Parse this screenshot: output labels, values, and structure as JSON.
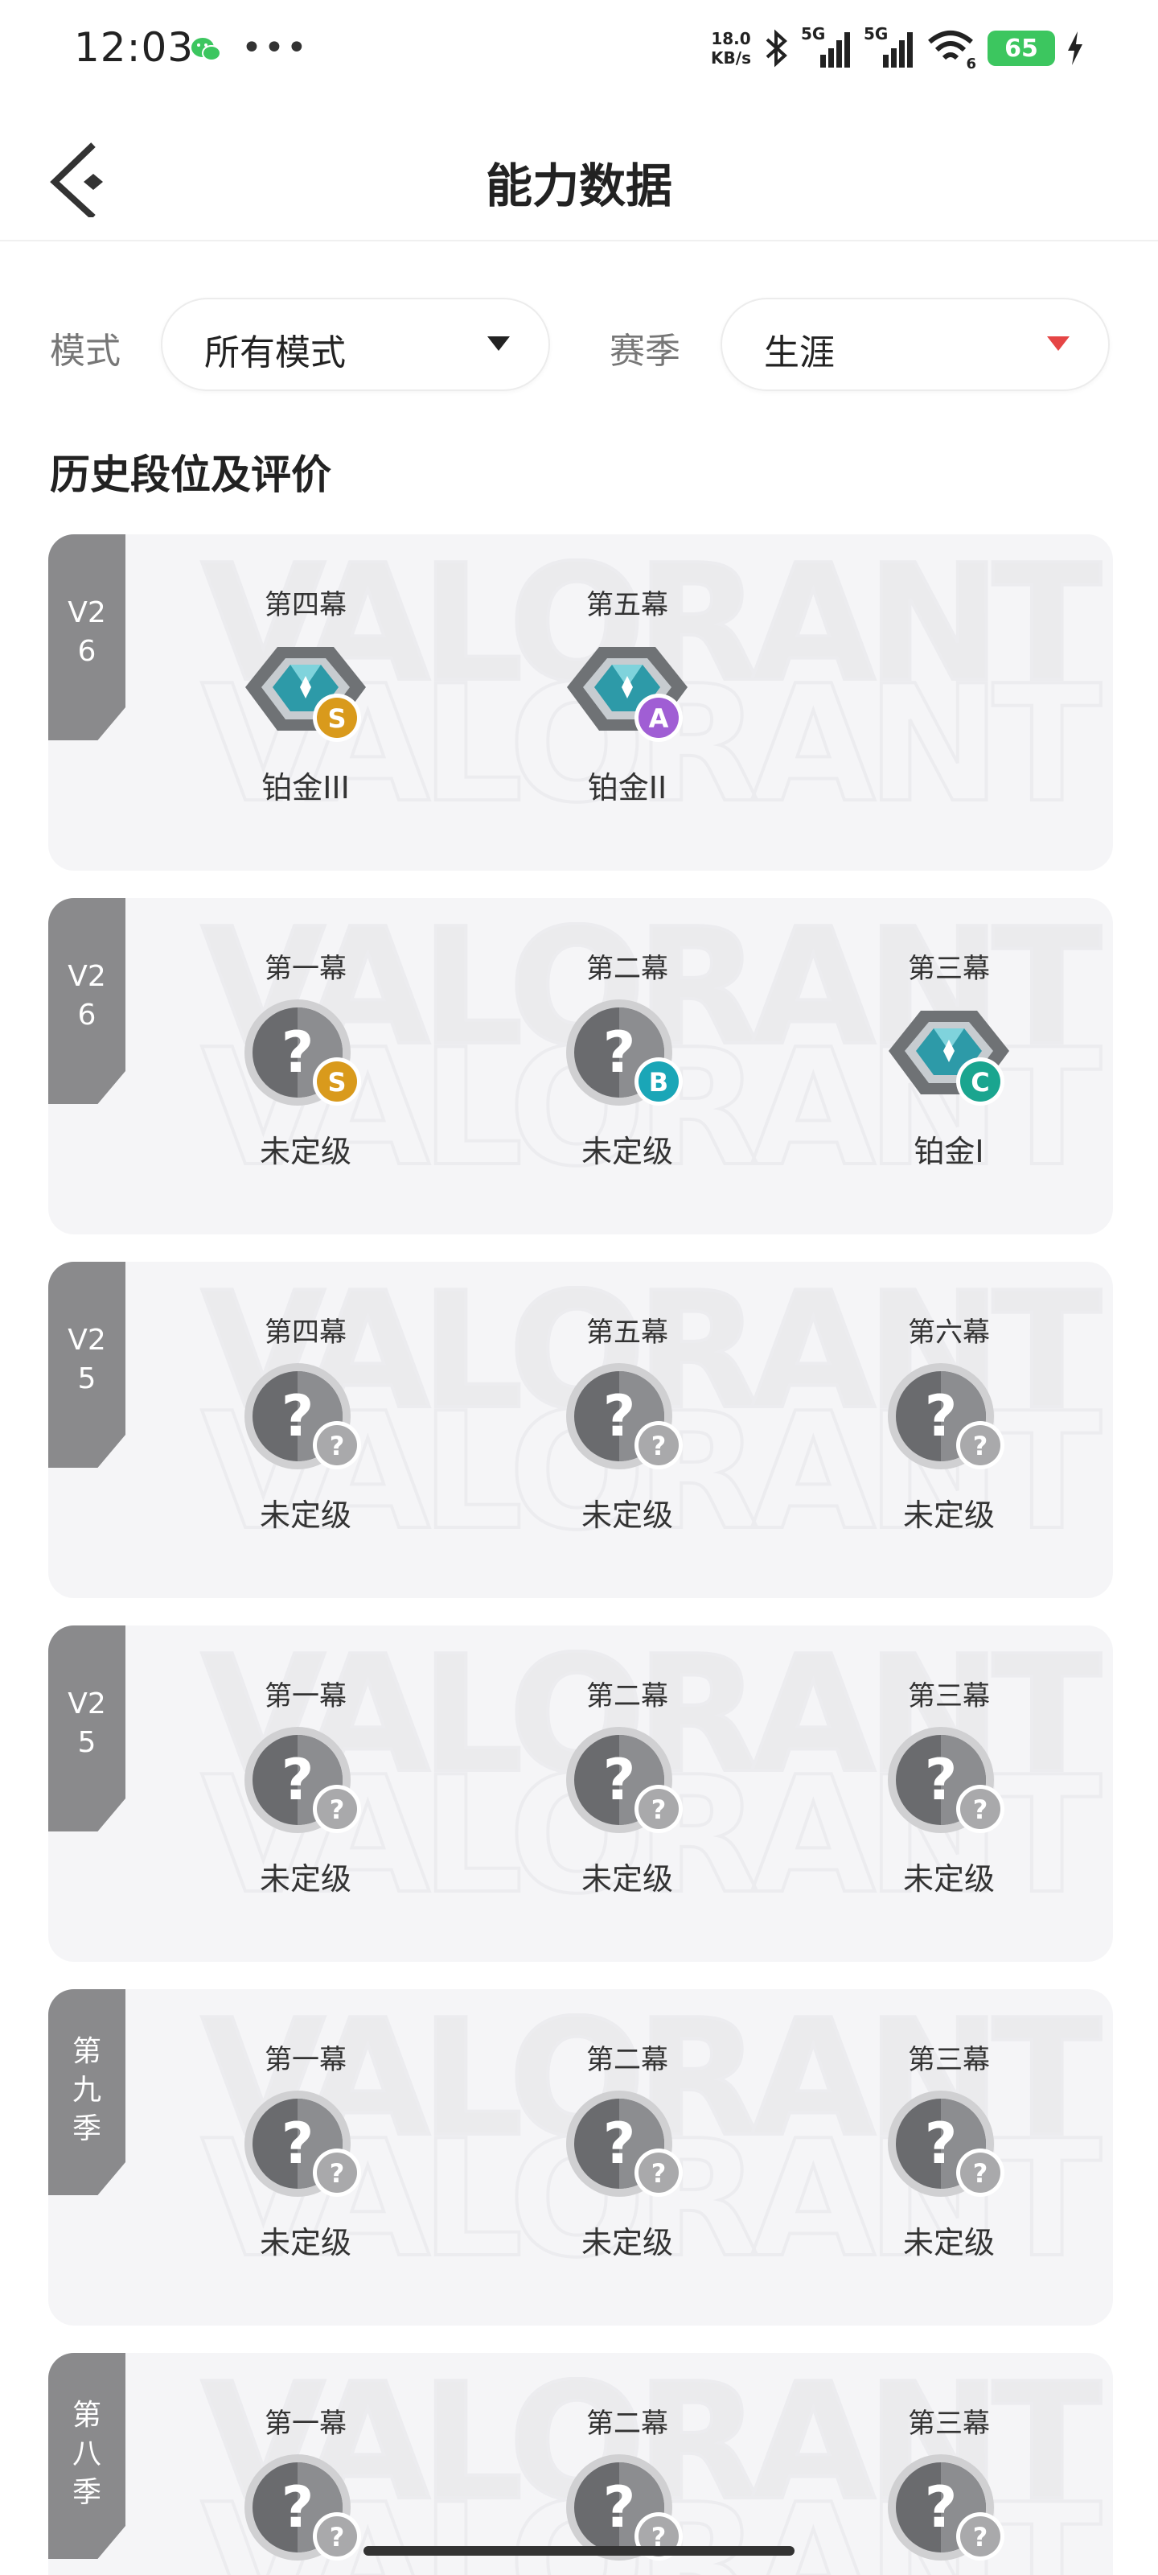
{
  "status_bar": {
    "time": "12:03",
    "net_speed": "18.0",
    "net_unit": "KB/s",
    "signal1": "5G",
    "signal2": "5G",
    "wifi_num": "6",
    "battery": "65",
    "icons": [
      "wechat-icon",
      "more-dots-icon",
      "bluetooth-icon",
      "signal-icon",
      "wifi-icon",
      "battery-icon",
      "charging-icon"
    ]
  },
  "header": {
    "title": "能力数据",
    "back_icon": "back-arrow-icon"
  },
  "filters": {
    "mode_label": "模式",
    "mode_value": "所有模式",
    "season_label": "赛季",
    "season_value": "生涯"
  },
  "section_title": "历史段位及评价",
  "watermark_text": "VALORANT",
  "colors": {
    "grade_S": "#d99a1c",
    "grade_A": "#a05ed4",
    "grade_B": "#1aa6b7",
    "grade_C": "#1aa58f",
    "grade_unknown": "#a9a9ab",
    "platinum": "#2d9aa8",
    "season_arrow_red": "#e54545"
  },
  "seasons": [
    {
      "tag": "V2\n6",
      "acts": [
        {
          "name": "第四幕",
          "rank": "铂金III",
          "icon": "platinum",
          "grade": "S"
        },
        {
          "name": "第五幕",
          "rank": "铂金II",
          "icon": "platinum",
          "grade": "A"
        }
      ]
    },
    {
      "tag": "V2\n6",
      "acts": [
        {
          "name": "第一幕",
          "rank": "未定级",
          "icon": "unranked",
          "grade": "S"
        },
        {
          "name": "第二幕",
          "rank": "未定级",
          "icon": "unranked",
          "grade": "B"
        },
        {
          "name": "第三幕",
          "rank": "铂金I",
          "icon": "platinum",
          "grade": "C"
        }
      ]
    },
    {
      "tag": "V2\n5",
      "acts": [
        {
          "name": "第四幕",
          "rank": "未定级",
          "icon": "unranked",
          "grade": "?"
        },
        {
          "name": "第五幕",
          "rank": "未定级",
          "icon": "unranked",
          "grade": "?"
        },
        {
          "name": "第六幕",
          "rank": "未定级",
          "icon": "unranked",
          "grade": "?"
        }
      ]
    },
    {
      "tag": "V2\n5",
      "acts": [
        {
          "name": "第一幕",
          "rank": "未定级",
          "icon": "unranked",
          "grade": "?"
        },
        {
          "name": "第二幕",
          "rank": "未定级",
          "icon": "unranked",
          "grade": "?"
        },
        {
          "name": "第三幕",
          "rank": "未定级",
          "icon": "unranked",
          "grade": "?"
        }
      ]
    },
    {
      "tag": "第\n九\n季",
      "acts": [
        {
          "name": "第一幕",
          "rank": "未定级",
          "icon": "unranked",
          "grade": "?"
        },
        {
          "name": "第二幕",
          "rank": "未定级",
          "icon": "unranked",
          "grade": "?"
        },
        {
          "name": "第三幕",
          "rank": "未定级",
          "icon": "unranked",
          "grade": "?"
        }
      ]
    },
    {
      "tag": "第\n八\n季",
      "acts": [
        {
          "name": "第一幕",
          "rank": "",
          "icon": "unranked",
          "grade": "?"
        },
        {
          "name": "第二幕",
          "rank": "",
          "icon": "unranked",
          "grade": "?"
        },
        {
          "name": "第三幕",
          "rank": "",
          "icon": "unranked",
          "grade": "?"
        }
      ]
    }
  ]
}
